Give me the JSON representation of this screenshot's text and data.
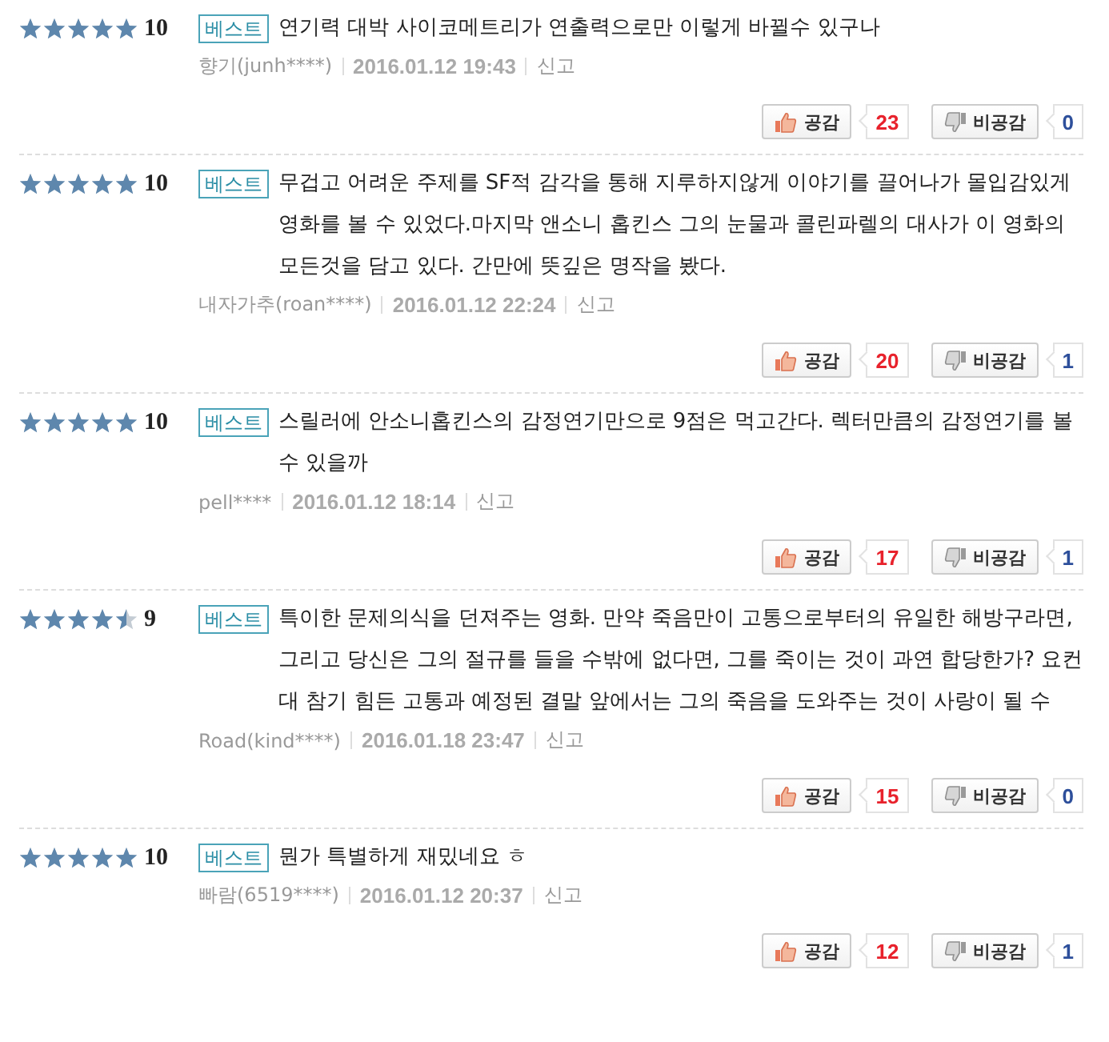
{
  "reviews": [
    {
      "stars": 5,
      "score": "10",
      "badge": "베스트",
      "text": "연기력 대박 사이코메트리가 연출력으로만 이렇게 바뀔수 있구나",
      "author": "향기(junh****)",
      "date": "2016.01.12 19:43",
      "report": "신고",
      "like_label": "공감",
      "like_count": "23",
      "dislike_label": "비공감",
      "dislike_count": "0"
    },
    {
      "stars": 5,
      "score": "10",
      "badge": "베스트",
      "text": "무겁고 어려운 주제를 SF적 감각을 통해 지루하지않게 이야기를 끌어나가 몰입감있게 영화를 볼 수 있었다.마지막 앤소니 홉킨스 그의 눈물과 콜린파렐의 대사가 이 영화의 모든것을 담고 있다. 간만에 뜻깊은 명작을 봤다.",
      "author": "내자가추(roan****)",
      "date": "2016.01.12 22:24",
      "report": "신고",
      "like_label": "공감",
      "like_count": "20",
      "dislike_label": "비공감",
      "dislike_count": "1"
    },
    {
      "stars": 5,
      "score": "10",
      "badge": "베스트",
      "text": "스릴러에 안소니홉킨스의 감정연기만으로 9점은 먹고간다. 렉터만큼의 감정연기를 볼수 있을까",
      "author": "pell****",
      "date": "2016.01.12 18:14",
      "report": "신고",
      "like_label": "공감",
      "like_count": "17",
      "dislike_label": "비공감",
      "dislike_count": "1"
    },
    {
      "stars": 4.5,
      "score": "9",
      "badge": "베스트",
      "text": "특이한 문제의식을 던져주는 영화. 만약 죽음만이 고통으로부터의 유일한 해방구라면, 그리고 당신은 그의 절규를 들을 수밖에 없다면, 그를 죽이는 것이 과연 합당한가? 요컨대 참기 힘든 고통과 예정된 결말 앞에서는 그의 죽음을 도와주는 것이 사랑이 될 수",
      "author": "Road(kind****)",
      "date": "2016.01.18 23:47",
      "report": "신고",
      "like_label": "공감",
      "like_count": "15",
      "dislike_label": "비공감",
      "dislike_count": "0"
    },
    {
      "stars": 5,
      "score": "10",
      "badge": "베스트",
      "text": "뭔가 특별하게 재밌네요 ㅎ",
      "author": "빠람(6519****)",
      "date": "2016.01.12 20:37",
      "report": "신고",
      "like_label": "공감",
      "like_count": "12",
      "dislike_label": "비공감",
      "dislike_count": "1"
    }
  ]
}
